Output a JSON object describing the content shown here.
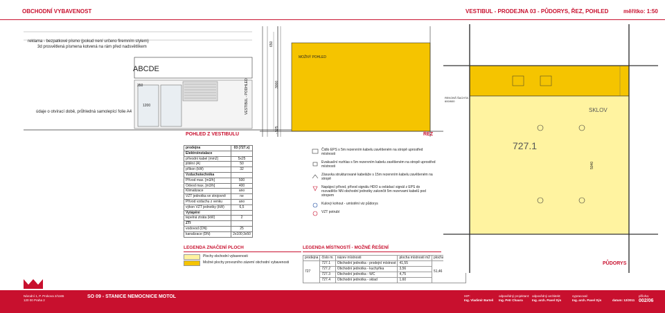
{
  "header": {
    "left_title": "OBCHODNÍ VYBAVENOST",
    "center_title": "VESTIBUL - PRODEJNA 03 - PŮDORYS, ŘEZ, POHLED",
    "scale": "měřítko: 1:50"
  },
  "facade": {
    "note1": "reklama - bezpatkové písmo (pokud není určeno firemním stylem)",
    "note2": "3d prosvětlená písmena kotvená na rám před nadsvětlíkem",
    "sign": "ABCDE",
    "note3": "údaje o otvírací době, průhledná samolepící folie A4",
    "dim1": "350",
    "dim2": "1200",
    "caption": "POHLED Z VESTIBULU"
  },
  "section": {
    "label_possible": "MOŽNÝ POHLED",
    "label_vestibul": "VESTIBUL - PODHLED",
    "dim_top": "650",
    "dim_mid": "3000",
    "dim_bot": "- 525",
    "caption": "ŘEZ"
  },
  "table": {
    "rows": [
      {
        "label": "prodejna",
        "value": "03 (727.x)",
        "bold": true
      },
      {
        "label": "Elektroinstalace",
        "value": "",
        "bold": true
      },
      {
        "label": "přívodní kabel (mm2)",
        "value": "5x25"
      },
      {
        "label": "jištění (A)",
        "value": "50"
      },
      {
        "label": "příkon (kW)",
        "value": "32"
      },
      {
        "label": "Vzduchotechnika",
        "value": "",
        "bold": true
      },
      {
        "label": "Přívod max. [m3/h]",
        "value": "500"
      },
      {
        "label": "Odvod max. [m3/h]",
        "value": "400"
      },
      {
        "label": "Klimatizace",
        "value": "ano"
      },
      {
        "label": "VZT jednotka ve strojovně",
        "value": "ne"
      },
      {
        "label": "Přívod vzduchu z venku",
        "value": "ano"
      },
      {
        "label": "výkon VZT jednotky (kW)",
        "value": "6,5"
      },
      {
        "label": "Vytápění",
        "value": "",
        "bold": true
      },
      {
        "label": "tepelná ztráta (kW)",
        "value": "2"
      },
      {
        "label": "ZTI",
        "value": "",
        "bold": true
      },
      {
        "label": "vodovod (DN)",
        "value": "25"
      },
      {
        "label": "kanalizace (DN)",
        "value": "2x100;3x50"
      }
    ]
  },
  "legend_floors": {
    "title": "LEGENDA ZNAČENÍ PLOCH",
    "item1": "Plochy obchodní vybavenosti",
    "item2": "Možné plochy provozního zázemí obchodní vybavenosti",
    "color1": "#fff3a0",
    "color2": "#f5c400"
  },
  "legend_items": [
    {
      "icon": "eps-icon",
      "text": "Čidlo EPS s 5m rezervním kabelu zavěšeném na stropě uprostřed místnosti"
    },
    {
      "icon": "evacuation-speaker-icon",
      "text": "Evakuační rozhlas s 5m rezervním kabelu zavěšeném na stropě uprostřed místnosti"
    },
    {
      "icon": "socket-icon",
      "text": "Zásuvka strukturované kabeláže s 15m rezervním kabelu zavěšeném na stropě"
    },
    {
      "icon": "power-supply-icon",
      "text": "Napájecí přívod, přívod signálu HDO a ovládací signál z EPS do rozvaděče NN obchodní jednotky zakončit 5m rezervami kabelů pod stropem"
    },
    {
      "icon": "valve-icon",
      "text": "Kulový kohout - umístění viz půdorys"
    },
    {
      "icon": "vzt-icon",
      "text": "VZT potrubí"
    }
  ],
  "rooms": {
    "title": "LEGENDA MÍSTNOSTÍ - MOŽNÉ ŘEŠENÍ",
    "headers": [
      "prodejna",
      "číslo m.",
      "název místnosti",
      "plocha místnosti m2",
      "plocha prodejny m2"
    ],
    "shop": "727",
    "total": "51,46",
    "rows": [
      {
        "num": "727.1",
        "name": "Obchodní jednotka - prodejní místnost",
        "area": "41,55"
      },
      {
        "num": "727.2",
        "name": "Obchodní jednotka - kuchyňka",
        "area": "3,56"
      },
      {
        "num": "727.3",
        "name": "Obchodní jednotka - WC",
        "area": "4,75"
      },
      {
        "num": "727.4",
        "name": "Obchodní jednotka - sklad",
        "area": "1,60"
      }
    ]
  },
  "plan": {
    "caption": "PŮDORYS",
    "room": "727.1",
    "sklad": "SKLOV",
    "dim": "5040",
    "rezerva": "REKONŠ ŠACHTA 600/600"
  },
  "footer": {
    "company1": "Národní 1, P. Prokova 2/1165",
    "company2": "120 00 Praha 2",
    "project": "SO 09 - STANICE NEMOCNICE MOTOL",
    "hip_label": "HIP:",
    "hip_name": "Ing. Vladimír Barteš",
    "proj_label": "odpovědný projektant:",
    "proj_name": "Ing. Petr Chaura",
    "arch_label": "odpovědný architekt:",
    "arch_name": "Ing. arch. Pavel Sýs",
    "drew_label": "vypracoval:",
    "drew_name": "Ing. arch. Pavel Sýs",
    "date_label": "datum: 12/2011",
    "sheet_label": "příloha:",
    "sheet": "002/06"
  }
}
